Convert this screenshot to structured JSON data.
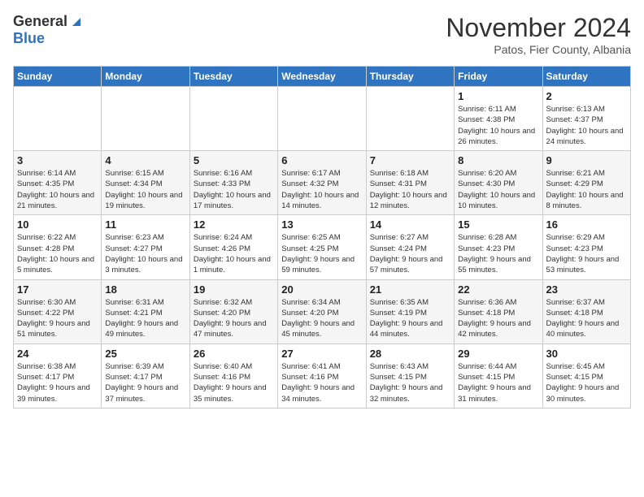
{
  "logo": {
    "general": "General",
    "blue": "Blue"
  },
  "title": {
    "month": "November 2024",
    "location": "Patos, Fier County, Albania"
  },
  "headers": [
    "Sunday",
    "Monday",
    "Tuesday",
    "Wednesday",
    "Thursday",
    "Friday",
    "Saturday"
  ],
  "weeks": [
    [
      {
        "day": "",
        "sunrise": "",
        "sunset": "",
        "daylight": ""
      },
      {
        "day": "",
        "sunrise": "",
        "sunset": "",
        "daylight": ""
      },
      {
        "day": "",
        "sunrise": "",
        "sunset": "",
        "daylight": ""
      },
      {
        "day": "",
        "sunrise": "",
        "sunset": "",
        "daylight": ""
      },
      {
        "day": "",
        "sunrise": "",
        "sunset": "",
        "daylight": ""
      },
      {
        "day": "1",
        "sunrise": "Sunrise: 6:11 AM",
        "sunset": "Sunset: 4:38 PM",
        "daylight": "Daylight: 10 hours and 26 minutes."
      },
      {
        "day": "2",
        "sunrise": "Sunrise: 6:13 AM",
        "sunset": "Sunset: 4:37 PM",
        "daylight": "Daylight: 10 hours and 24 minutes."
      }
    ],
    [
      {
        "day": "3",
        "sunrise": "Sunrise: 6:14 AM",
        "sunset": "Sunset: 4:35 PM",
        "daylight": "Daylight: 10 hours and 21 minutes."
      },
      {
        "day": "4",
        "sunrise": "Sunrise: 6:15 AM",
        "sunset": "Sunset: 4:34 PM",
        "daylight": "Daylight: 10 hours and 19 minutes."
      },
      {
        "day": "5",
        "sunrise": "Sunrise: 6:16 AM",
        "sunset": "Sunset: 4:33 PM",
        "daylight": "Daylight: 10 hours and 17 minutes."
      },
      {
        "day": "6",
        "sunrise": "Sunrise: 6:17 AM",
        "sunset": "Sunset: 4:32 PM",
        "daylight": "Daylight: 10 hours and 14 minutes."
      },
      {
        "day": "7",
        "sunrise": "Sunrise: 6:18 AM",
        "sunset": "Sunset: 4:31 PM",
        "daylight": "Daylight: 10 hours and 12 minutes."
      },
      {
        "day": "8",
        "sunrise": "Sunrise: 6:20 AM",
        "sunset": "Sunset: 4:30 PM",
        "daylight": "Daylight: 10 hours and 10 minutes."
      },
      {
        "day": "9",
        "sunrise": "Sunrise: 6:21 AM",
        "sunset": "Sunset: 4:29 PM",
        "daylight": "Daylight: 10 hours and 8 minutes."
      }
    ],
    [
      {
        "day": "10",
        "sunrise": "Sunrise: 6:22 AM",
        "sunset": "Sunset: 4:28 PM",
        "daylight": "Daylight: 10 hours and 5 minutes."
      },
      {
        "day": "11",
        "sunrise": "Sunrise: 6:23 AM",
        "sunset": "Sunset: 4:27 PM",
        "daylight": "Daylight: 10 hours and 3 minutes."
      },
      {
        "day": "12",
        "sunrise": "Sunrise: 6:24 AM",
        "sunset": "Sunset: 4:26 PM",
        "daylight": "Daylight: 10 hours and 1 minute."
      },
      {
        "day": "13",
        "sunrise": "Sunrise: 6:25 AM",
        "sunset": "Sunset: 4:25 PM",
        "daylight": "Daylight: 9 hours and 59 minutes."
      },
      {
        "day": "14",
        "sunrise": "Sunrise: 6:27 AM",
        "sunset": "Sunset: 4:24 PM",
        "daylight": "Daylight: 9 hours and 57 minutes."
      },
      {
        "day": "15",
        "sunrise": "Sunrise: 6:28 AM",
        "sunset": "Sunset: 4:23 PM",
        "daylight": "Daylight: 9 hours and 55 minutes."
      },
      {
        "day": "16",
        "sunrise": "Sunrise: 6:29 AM",
        "sunset": "Sunset: 4:23 PM",
        "daylight": "Daylight: 9 hours and 53 minutes."
      }
    ],
    [
      {
        "day": "17",
        "sunrise": "Sunrise: 6:30 AM",
        "sunset": "Sunset: 4:22 PM",
        "daylight": "Daylight: 9 hours and 51 minutes."
      },
      {
        "day": "18",
        "sunrise": "Sunrise: 6:31 AM",
        "sunset": "Sunset: 4:21 PM",
        "daylight": "Daylight: 9 hours and 49 minutes."
      },
      {
        "day": "19",
        "sunrise": "Sunrise: 6:32 AM",
        "sunset": "Sunset: 4:20 PM",
        "daylight": "Daylight: 9 hours and 47 minutes."
      },
      {
        "day": "20",
        "sunrise": "Sunrise: 6:34 AM",
        "sunset": "Sunset: 4:20 PM",
        "daylight": "Daylight: 9 hours and 45 minutes."
      },
      {
        "day": "21",
        "sunrise": "Sunrise: 6:35 AM",
        "sunset": "Sunset: 4:19 PM",
        "daylight": "Daylight: 9 hours and 44 minutes."
      },
      {
        "day": "22",
        "sunrise": "Sunrise: 6:36 AM",
        "sunset": "Sunset: 4:18 PM",
        "daylight": "Daylight: 9 hours and 42 minutes."
      },
      {
        "day": "23",
        "sunrise": "Sunrise: 6:37 AM",
        "sunset": "Sunset: 4:18 PM",
        "daylight": "Daylight: 9 hours and 40 minutes."
      }
    ],
    [
      {
        "day": "24",
        "sunrise": "Sunrise: 6:38 AM",
        "sunset": "Sunset: 4:17 PM",
        "daylight": "Daylight: 9 hours and 39 minutes."
      },
      {
        "day": "25",
        "sunrise": "Sunrise: 6:39 AM",
        "sunset": "Sunset: 4:17 PM",
        "daylight": "Daylight: 9 hours and 37 minutes."
      },
      {
        "day": "26",
        "sunrise": "Sunrise: 6:40 AM",
        "sunset": "Sunset: 4:16 PM",
        "daylight": "Daylight: 9 hours and 35 minutes."
      },
      {
        "day": "27",
        "sunrise": "Sunrise: 6:41 AM",
        "sunset": "Sunset: 4:16 PM",
        "daylight": "Daylight: 9 hours and 34 minutes."
      },
      {
        "day": "28",
        "sunrise": "Sunrise: 6:43 AM",
        "sunset": "Sunset: 4:15 PM",
        "daylight": "Daylight: 9 hours and 32 minutes."
      },
      {
        "day": "29",
        "sunrise": "Sunrise: 6:44 AM",
        "sunset": "Sunset: 4:15 PM",
        "daylight": "Daylight: 9 hours and 31 minutes."
      },
      {
        "day": "30",
        "sunrise": "Sunrise: 6:45 AM",
        "sunset": "Sunset: 4:15 PM",
        "daylight": "Daylight: 9 hours and 30 minutes."
      }
    ]
  ]
}
